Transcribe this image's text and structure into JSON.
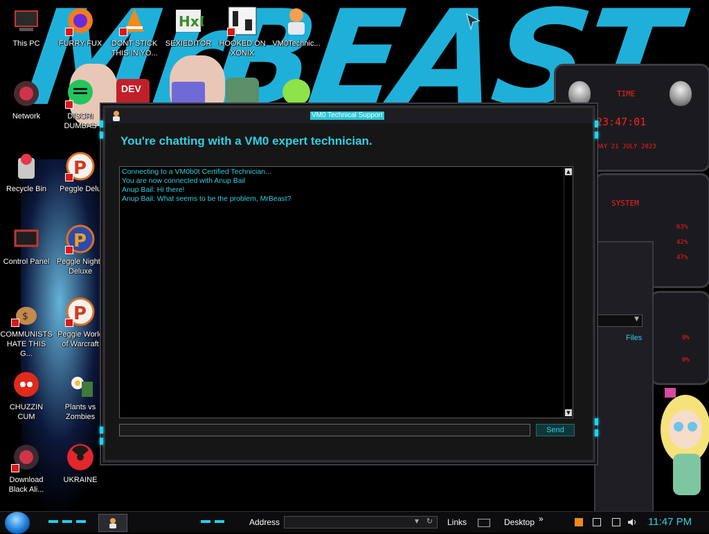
{
  "colors": {
    "accent": "#2ed0e3",
    "window_bg": "#161616",
    "log_bg": "#000000",
    "red": "#ff1a1a",
    "wallpaper_brand": "#1fb0d9"
  },
  "wallpaper": {
    "brand_text": "MrBEAST"
  },
  "desktop_icons": [
    {
      "label": "This PC",
      "icon": "computer-icon"
    },
    {
      "label": "FURRY FUX",
      "icon": "firefox-icon"
    },
    {
      "label": "DONT STICK THIS IN YO...",
      "icon": "vlc-icon"
    },
    {
      "label": "SEXIEDITOR",
      "icon": "hex-editor-icon"
    },
    {
      "label": "HOOKED ON XONIX",
      "icon": "xonix-icon"
    },
    {
      "label": "VM0Technic...",
      "icon": "technician-icon"
    },
    {
      "label": "Network",
      "icon": "network-icon"
    },
    {
      "label": "DISCRI DUMBAS",
      "icon": "discord-icon"
    },
    {
      "label": "Recycle Bin",
      "icon": "recycle-bin-icon"
    },
    {
      "label": "Peggle Delu",
      "icon": "peggle-icon"
    },
    {
      "label": "Control Panel",
      "icon": "control-panel-icon"
    },
    {
      "label": "Peggle Nights Deluxe",
      "icon": "peggle-nights-icon"
    },
    {
      "label": "COMMUNISTS HATE THIS G...",
      "icon": "money-bag-icon"
    },
    {
      "label": "Peggle World of Warcraft",
      "icon": "peggle-wow-icon"
    },
    {
      "label": "CHUZZIN CUM",
      "icon": "chuzzle-icon"
    },
    {
      "label": "Plants vs Zombies",
      "icon": "plants-vs-zombies-icon"
    },
    {
      "label": "Download Black Ali...",
      "icon": "alien-download-icon"
    },
    {
      "label": "UKRAINE",
      "icon": "radiation-icon"
    }
  ],
  "gadgets": {
    "time": {
      "title": "TIME",
      "clock": "23:47:01",
      "date": "DAY 21 JULY 2023"
    },
    "system": {
      "title": "SYSTEM",
      "values": [
        "63%",
        "42%",
        "47%"
      ]
    },
    "drives": {
      "values": [
        "0%",
        "0%"
      ]
    }
  },
  "background_window": {
    "link": "Files"
  },
  "chat_window": {
    "title": "VM0 Technical Support",
    "heading": "You're chatting with a VM0 expert technician.",
    "messages": [
      "Connecting to a VM0b0t Certified Technician...",
      "You are now connected with Anup Bail",
      "Anup Bail: Hi there!",
      "Anup Bail: What seems to be the problem, MrBeast?"
    ],
    "input_value": "",
    "send_label": "Send"
  },
  "taskbar": {
    "address_label": "Address",
    "address_value": "",
    "links_label": "Links",
    "desktop_label": "Desktop",
    "chevron": "»",
    "clock": "11:47 PM"
  }
}
